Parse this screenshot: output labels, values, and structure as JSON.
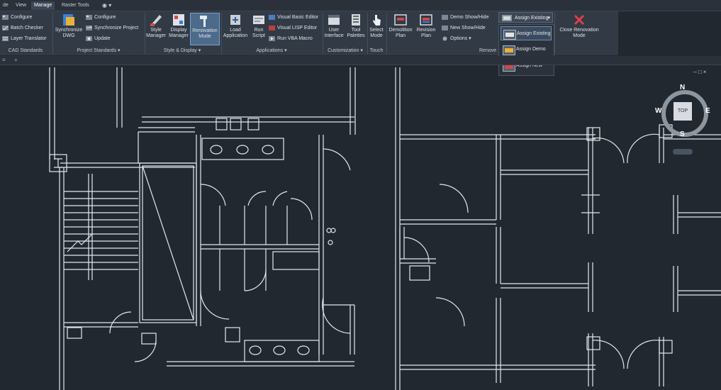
{
  "tabs": [
    {
      "label": "de"
    },
    {
      "label": "View"
    },
    {
      "label": "Manage"
    },
    {
      "label": "Raster Tools"
    }
  ],
  "panels": {
    "cad_standards": {
      "label": "CAD Standards",
      "configure": "Configure",
      "batch_checker": "Batch Checker",
      "layer_translator": "Layer Translator"
    },
    "project_standards": {
      "label": "Project Standards",
      "synchronize_dwg": "Synchronize DWG",
      "configure": "Configure",
      "synchronize_project": "Synchronize Project",
      "update": "Update"
    },
    "style_display": {
      "label": "Style & Display",
      "style_manager": "Style Manager",
      "display_manager": "Display Manager",
      "renovation_mode": "Renovation Mode"
    },
    "applications": {
      "label": "Applications",
      "load_application": "Load Application",
      "run_script": "Run Script",
      "visual_basic_editor": "Visual Basic Editor",
      "visual_lisp_editor": "Visual LISP Editor",
      "run_vba_macro": "Run VBA Macro"
    },
    "customization": {
      "label": "Customization",
      "user_interface": "User Interface",
      "tool_palettes": "Tool Palettes"
    },
    "touch": {
      "label": "Touch",
      "select_mode": "Select Mode"
    },
    "renovation": {
      "label": "Renove",
      "demolition_plan": "Demolition Plan",
      "revision_plan": "Revision Plan",
      "demo_show_hide": "Demo Show/Hide",
      "new_show_hide": "New Show/Hide",
      "options": "Options",
      "assign_existing": "Assign Existing",
      "close_renovation_mode": "Close Renovation Mode"
    }
  },
  "dropdown": {
    "items": [
      {
        "label": "Assign Existing"
      },
      {
        "label": "Assign Demo"
      },
      {
        "label": "Assign New"
      }
    ]
  },
  "viewcube": {
    "north": "N",
    "south": "S",
    "east": "E",
    "west": "W",
    "top": "TOP"
  },
  "colors": {
    "background": "#212830",
    "ribbon": "#323a45",
    "accent": "#4c6a8a",
    "close_red": "#e0404a"
  }
}
